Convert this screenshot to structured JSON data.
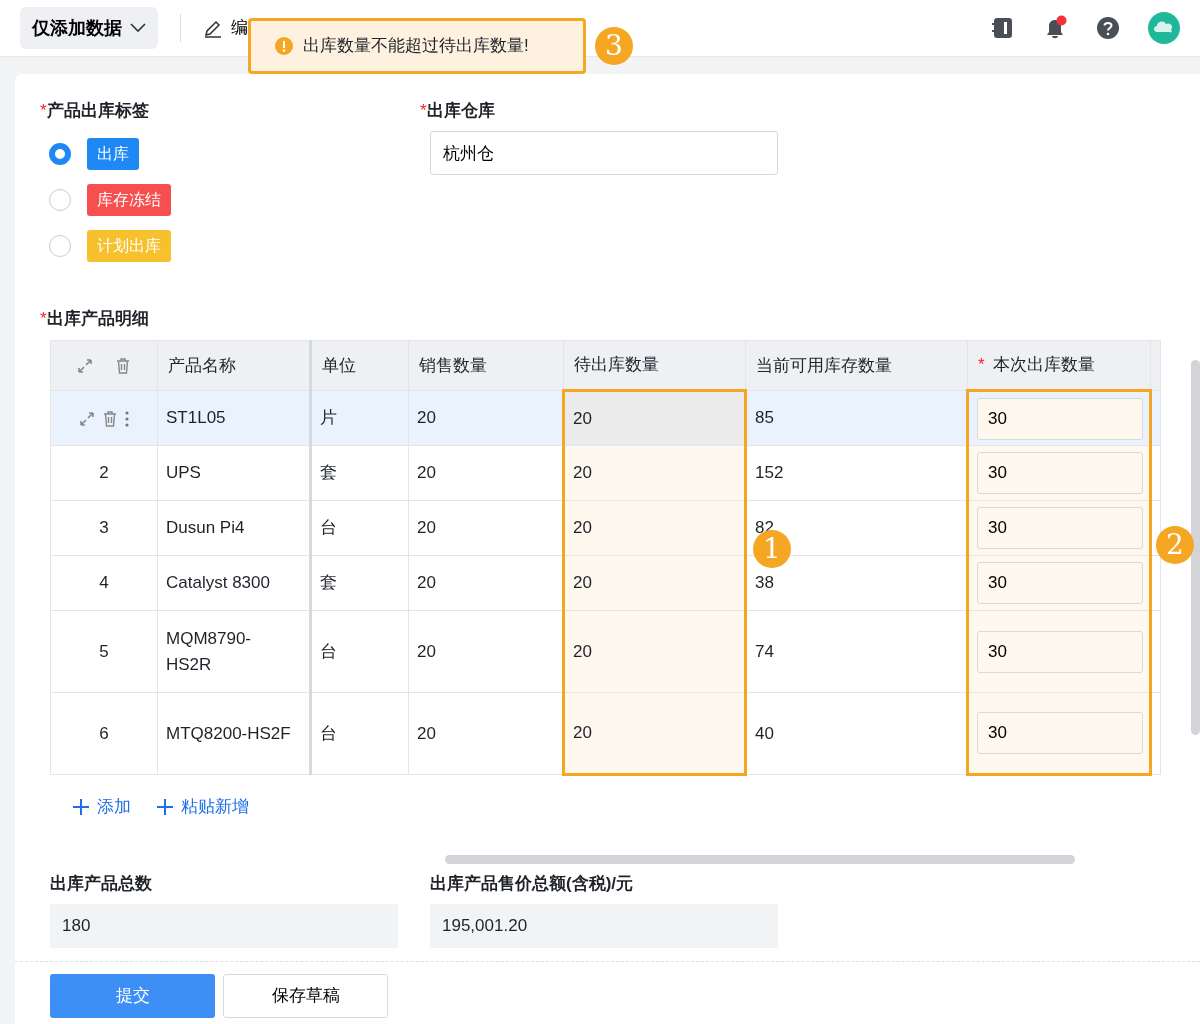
{
  "toolbar": {
    "view_menu": "仅添加数据",
    "edit_button": "编"
  },
  "toast": {
    "message": "出库数量不能超过待出库数量!"
  },
  "form": {
    "tag_field": {
      "label": "产品出库标签",
      "required_mark": "*",
      "options": [
        {
          "label": "出库",
          "selected": true,
          "color": "#1e88f5"
        },
        {
          "label": "库存冻结",
          "selected": false,
          "color": "#f5504f"
        },
        {
          "label": "计划出库",
          "selected": false,
          "color": "#f7c12e"
        }
      ]
    },
    "warehouse_field": {
      "label": "出库仓库",
      "required_mark": "*",
      "value": "杭州仓"
    },
    "detail_label": {
      "label": "出库产品明细",
      "required_mark": "*"
    },
    "table": {
      "columns": [
        {
          "label": "产品名称",
          "highlighted": false
        },
        {
          "label": "单位",
          "highlighted": false
        },
        {
          "label": "销售数量",
          "highlighted": false
        },
        {
          "label": "待出库数量",
          "highlighted": true
        },
        {
          "label": "当前可用库存数量",
          "highlighted": false
        },
        {
          "label": "本次出库数量",
          "required_mark": "*",
          "highlighted": true
        }
      ],
      "rows": [
        {
          "hovered": true,
          "selected": true,
          "name": "ST1L05",
          "unit": "片",
          "sales": "20",
          "pending": "20",
          "available": "85",
          "quantity": "30"
        },
        {
          "index": "2",
          "hovered": false,
          "selected": false,
          "name": "UPS",
          "unit": "套",
          "sales": "20",
          "pending": "20",
          "available": "152",
          "quantity": "30"
        },
        {
          "index": "3",
          "hovered": false,
          "selected": false,
          "name": "Dusun Pi4",
          "unit": "台",
          "sales": "20",
          "pending": "20",
          "available": "82",
          "quantity": "30"
        },
        {
          "index": "4",
          "hovered": false,
          "selected": false,
          "name": "Catalyst 8300",
          "unit": "套",
          "sales": "20",
          "pending": "20",
          "available": "38",
          "quantity": "30"
        },
        {
          "index": "5",
          "hovered": false,
          "selected": false,
          "name": "MQM8790-HS2R",
          "unit": "台",
          "sales": "20",
          "pending": "20",
          "available": "74",
          "quantity": "30"
        },
        {
          "index": "6",
          "hovered": false,
          "selected": false,
          "name": "MTQ8200-HS2F",
          "unit": "台",
          "sales": "20",
          "pending": "20",
          "available": "40",
          "quantity": "30"
        }
      ]
    },
    "add_links": [
      "添加",
      "粘贴新增"
    ],
    "total_count": {
      "label": "出库产品总数",
      "value": "180"
    },
    "total_amount": {
      "label": "出库产品售价总额(含税)/元",
      "value": "195,001.20"
    },
    "buttons": [
      {
        "label": "提交",
        "kind": "primary"
      },
      {
        "label": "保存草稿",
        "kind": "secondary"
      }
    ]
  },
  "annotations": [
    {
      "label": "1"
    },
    {
      "label": "2"
    },
    {
      "label": "3"
    }
  ]
}
